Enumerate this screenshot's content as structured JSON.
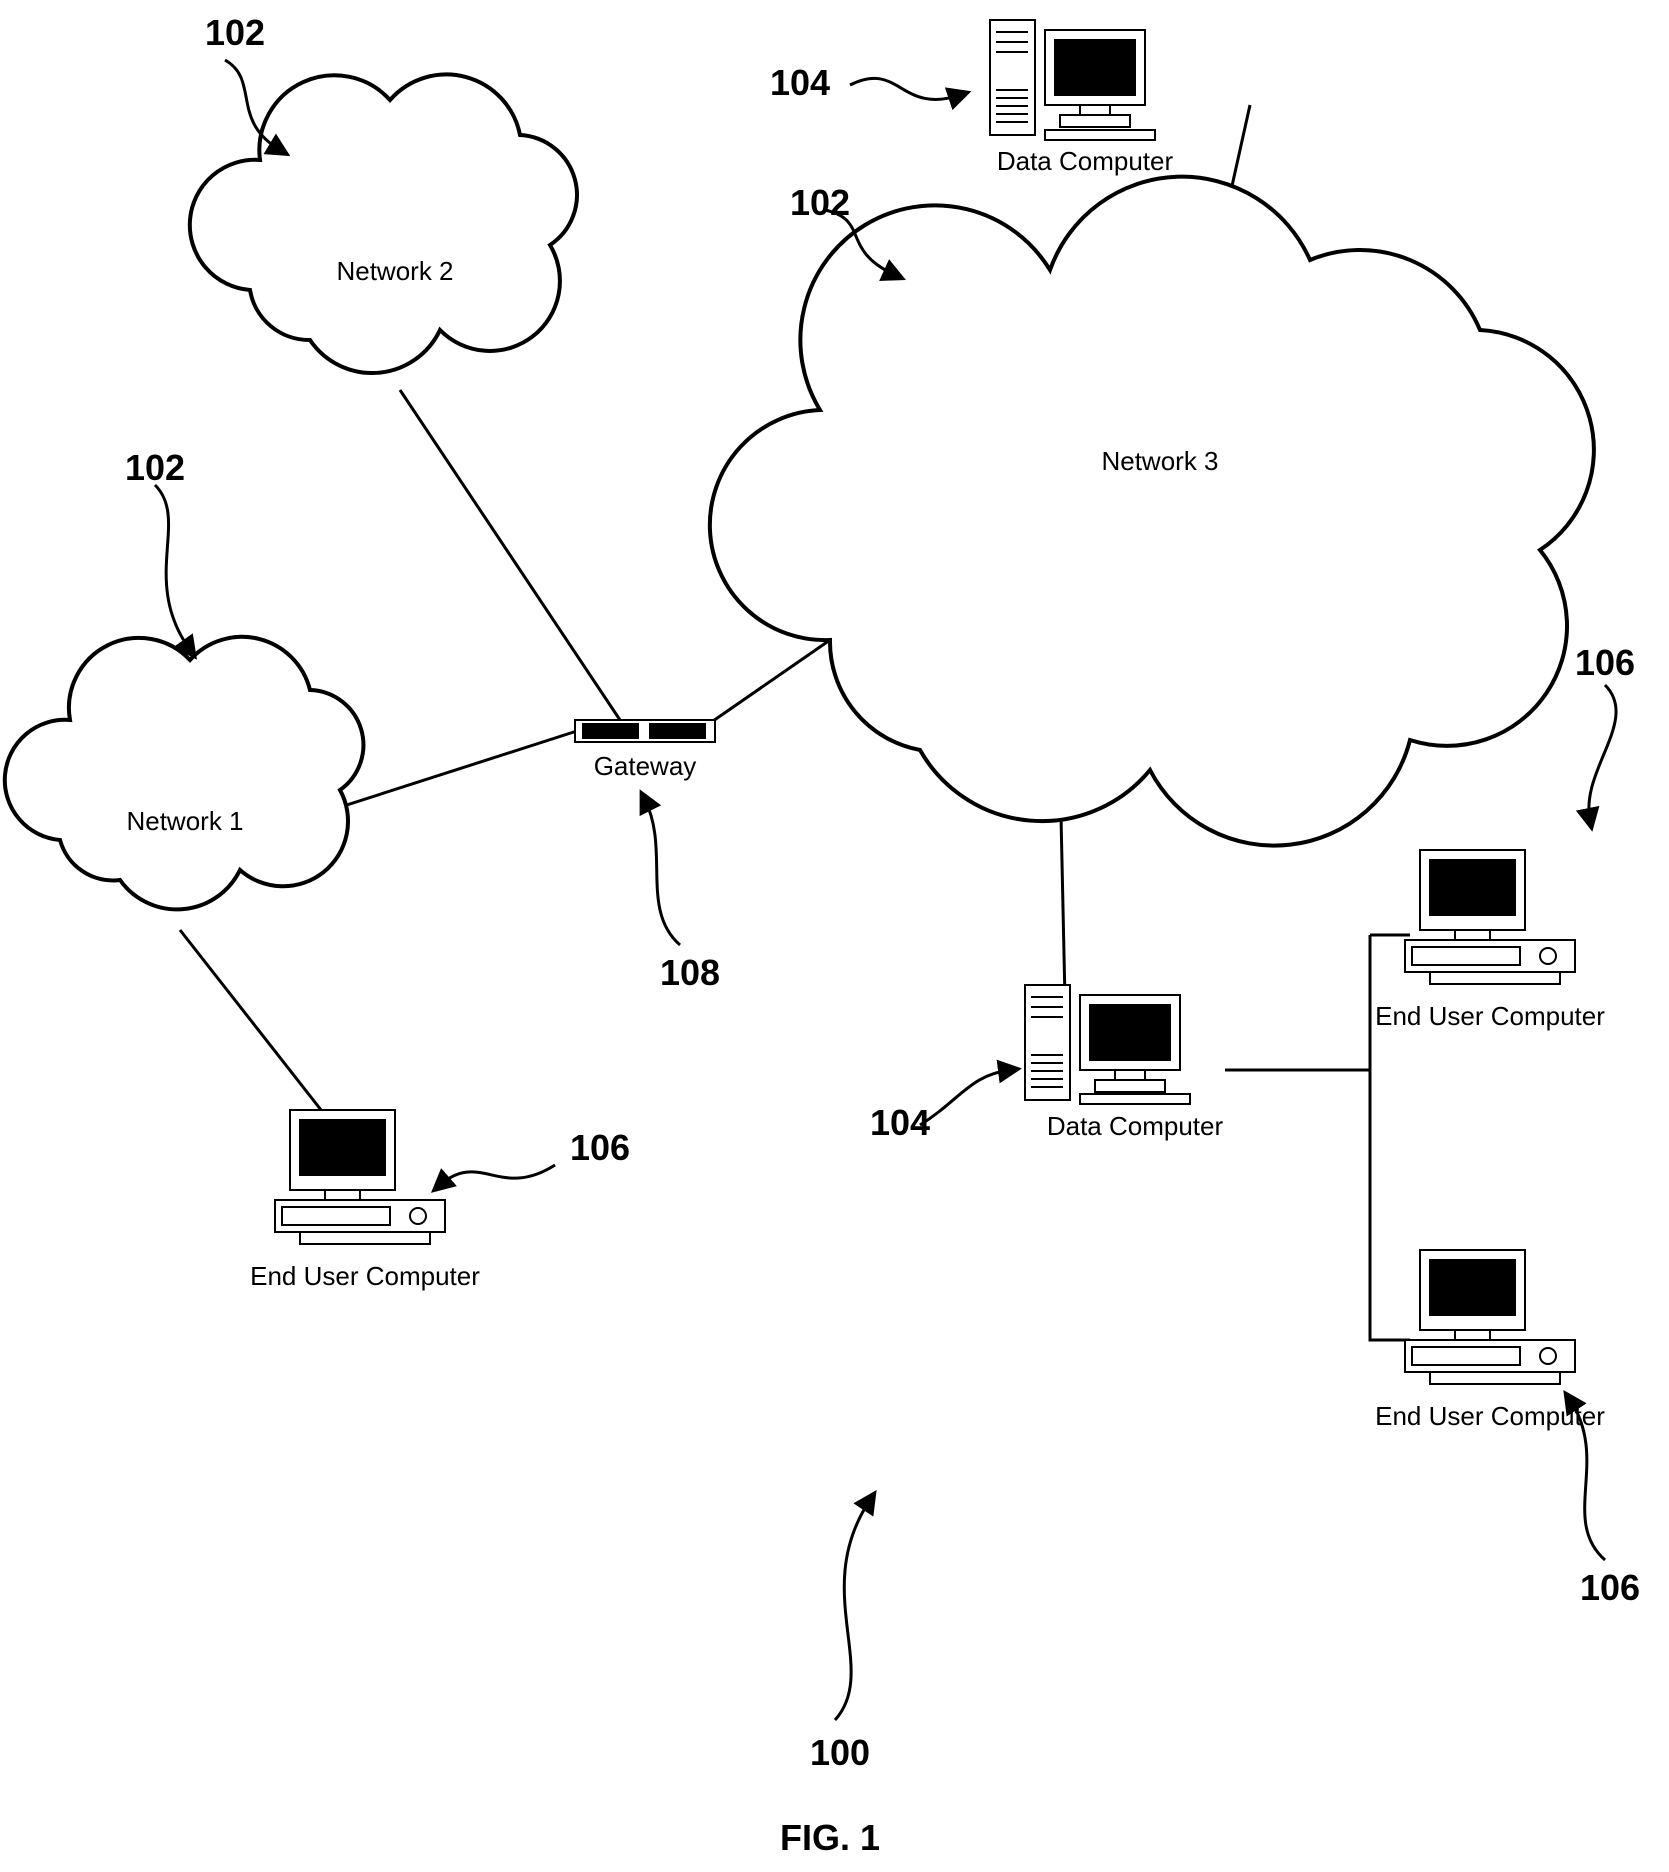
{
  "refs": {
    "r102a": "102",
    "r102b": "102",
    "r102c": "102",
    "r104a": "104",
    "r104b": "104",
    "r106a": "106",
    "r106b": "106",
    "r106c": "106",
    "r108": "108",
    "r100": "100"
  },
  "labels": {
    "net1": "Network 1",
    "net2": "Network 2",
    "net3": "Network 3",
    "gateway": "Gateway",
    "dataComputer1": "Data Computer",
    "dataComputer2": "Data Computer",
    "endUser1": "End User Computer",
    "endUser2": "End User Computer",
    "endUser3": "End User Computer"
  },
  "figure": "FIG. 1"
}
